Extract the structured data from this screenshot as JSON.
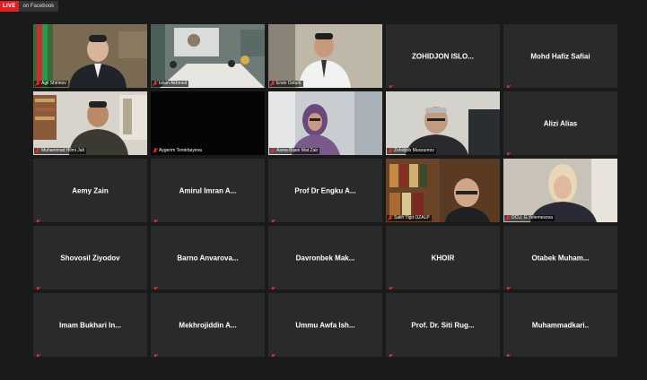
{
  "header": {
    "live_label": "LIVE",
    "platform_label": "on Facebook"
  },
  "colors": {
    "active_outline": "#f0e04a",
    "tile_bg": "#2a2a2a",
    "muted_mic": "#e03030"
  },
  "tiles": [
    {
      "name": "Agil Shirinov",
      "video": true
    },
    {
      "name": "Islam Akhmed",
      "video": true
    },
    {
      "name": "Ersin Ozturk",
      "video": true
    },
    {
      "name": "ZOHIDJON ISLO...",
      "video": false
    },
    {
      "name": "Mohd Hafiz Safiai",
      "video": false
    },
    {
      "name": "Muhammad Hilmi Jali",
      "video": true
    },
    {
      "name": "Aygerim Temirbayeva",
      "video": true
    },
    {
      "name": "Asma Bijani Mat Zair",
      "video": true
    },
    {
      "name": "Zohidjob Muxsumov",
      "video": true
    },
    {
      "name": "Alizi Alias",
      "video": false
    },
    {
      "name": "Aemy Zain",
      "video": false
    },
    {
      "name": "Amirul Imran A...",
      "video": false
    },
    {
      "name": "Prof Dr Engku A...",
      "video": false
    },
    {
      "name": "Salih Yigit OZALP",
      "video": true
    },
    {
      "name": "DCU, G.Yelemesova",
      "video": true
    },
    {
      "name": "Shovosil Ziyodov",
      "video": false
    },
    {
      "name": "Barno Anvarova...",
      "video": false
    },
    {
      "name": "Davronbek Mak...",
      "video": false
    },
    {
      "name": "KHOIR",
      "video": false
    },
    {
      "name": "Otabek Muham...",
      "video": false
    },
    {
      "name": "Imam Bukhari In...",
      "video": false
    },
    {
      "name": "Mekhrojiddin A...",
      "video": false
    },
    {
      "name": "Ummu Awfa Ish...",
      "video": false
    },
    {
      "name": "Prof. Dr. Siti Rug...",
      "video": false
    },
    {
      "name": "Muhammadkari..",
      "video": false
    }
  ]
}
